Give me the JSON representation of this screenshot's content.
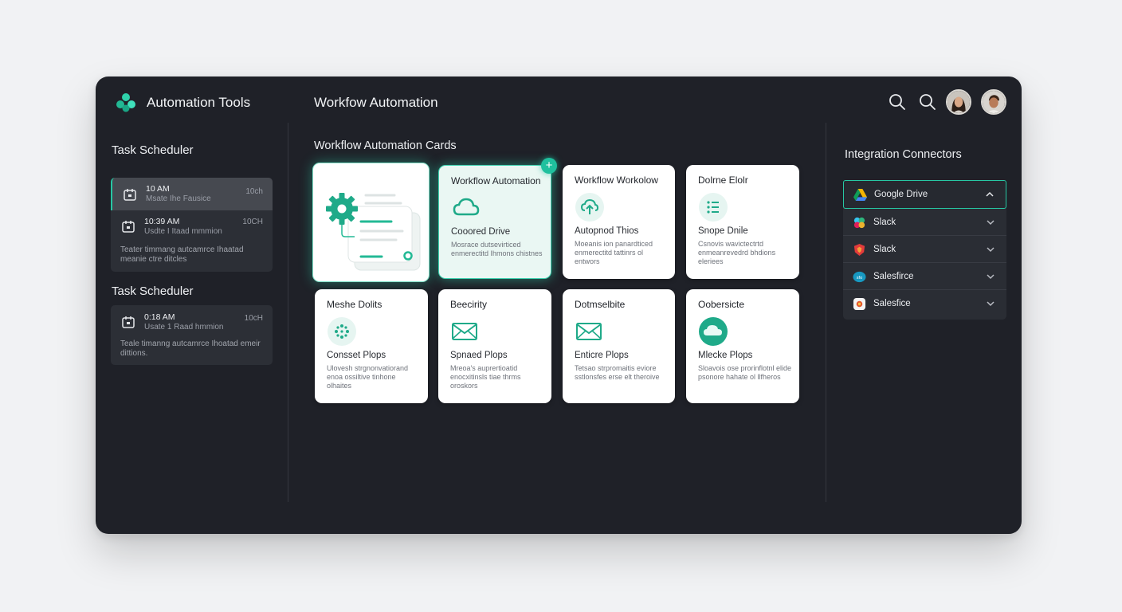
{
  "header": {
    "app_title": "Automation Tools",
    "page_title": "Workfow Automation"
  },
  "left": {
    "section1_title": "Task Scheduler",
    "section2_title": "Task Scheduler",
    "tasks1": [
      {
        "time": "10 AM",
        "sub": "Msate Ihe Fausice",
        "dur": "10ch"
      },
      {
        "time": "10:39 AM",
        "sub": "Usdte I Itaad mmmion",
        "dur": "10CH",
        "desc": "Teater timmang autcamrce Ihaatad meanie ctre ditcles"
      }
    ],
    "tasks2": [
      {
        "time": "0:18 AM",
        "sub": "Usate 1 Raad hmmion",
        "dur": "10cH",
        "desc": "Teale timanng autcamrce Ihoatad emeir dittions."
      }
    ]
  },
  "main": {
    "section_title": "Workflow Automation Cards",
    "cards": [
      {
        "title": "Workflow Automation",
        "head": "Cooored Drive",
        "desc": "Mosrace dutsevirticed enmerectitd Ihmons chistnes",
        "icon": "cloud-icon"
      },
      {
        "title": "Workflow Workolow",
        "head": "Autopnod Thios",
        "desc": "Moeanis ion panardticed enmerectitd tattinrs ol entwors",
        "icon": "cloud-upload-icon"
      },
      {
        "title": "Dolrne Elolr",
        "head": "Snope Dnile",
        "desc": "Csnovis wavictectrtd enmeanrevedrd bhdions eleriees",
        "icon": "list-icon"
      },
      {
        "title": "Meshe Dolits",
        "head": "Consset Plops",
        "desc": "Ulovesh strgnonvatiorand enoa ossiltive tinhone olhaites",
        "icon": "dots-icon"
      },
      {
        "title": "Beecirity",
        "head": "Spnaed Plops",
        "desc": "Mreoa's auprertioatid enocxitinsls tiae thrms oroskors",
        "icon": "mail-icon"
      },
      {
        "title": "Dotmselbite",
        "head": "Enticre Plops",
        "desc": "Tetsao strpromaitis eviore sstlonsfes erse elt theroive",
        "icon": "mail-icon"
      },
      {
        "title": "Oobersicte",
        "head": "Mlecke Plops",
        "desc": "Sloavois ose prorinflotnl elide psonore hahate ol llfheros",
        "icon": "cloud-solid-icon"
      }
    ]
  },
  "right": {
    "section_title": "Integration Connectors",
    "connectors": [
      {
        "label": "Google Drive",
        "logo": "google-drive-icon"
      },
      {
        "label": "Slack",
        "logo": "slack-icon"
      },
      {
        "label": "Slack",
        "logo": "slack-red-icon"
      },
      {
        "label": "Salesfirce",
        "logo": "salesforce-icon"
      },
      {
        "label": "Salesfice",
        "logo": "salesforce-alt-icon"
      }
    ]
  },
  "colors": {
    "accent": "#27c7a3",
    "window_bg": "#1f2128",
    "page_bg": "#f1f2f4"
  }
}
